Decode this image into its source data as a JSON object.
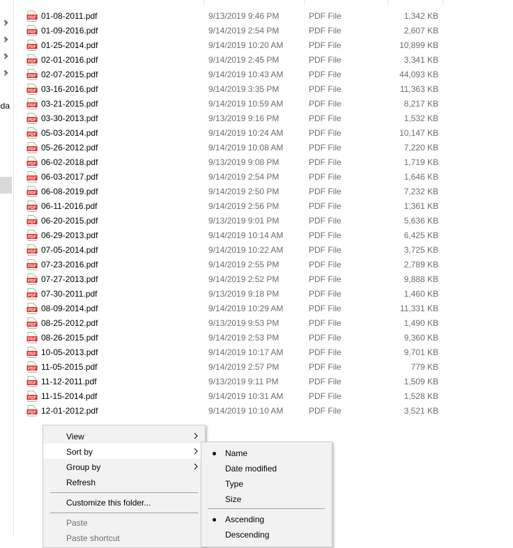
{
  "files": [
    {
      "name": "01-08-2011.pdf",
      "date": "9/13/2019 9:46 PM",
      "type": "PDF File",
      "size": "1,342 KB"
    },
    {
      "name": "01-09-2016.pdf",
      "date": "9/14/2019 2:54 PM",
      "type": "PDF File",
      "size": "2,607 KB"
    },
    {
      "name": "01-25-2014.pdf",
      "date": "9/14/2019 10:20 AM",
      "type": "PDF File",
      "size": "10,899 KB"
    },
    {
      "name": "02-01-2016.pdf",
      "date": "9/14/2019 2:45 PM",
      "type": "PDF File",
      "size": "3,341 KB"
    },
    {
      "name": "02-07-2015.pdf",
      "date": "9/14/2019 10:43 AM",
      "type": "PDF File",
      "size": "44,093 KB"
    },
    {
      "name": "03-16-2016.pdf",
      "date": "9/14/2019 3:35 PM",
      "type": "PDF File",
      "size": "11,363 KB"
    },
    {
      "name": "03-21-2015.pdf",
      "date": "9/14/2019 10:59 AM",
      "type": "PDF File",
      "size": "8,217 KB"
    },
    {
      "name": "03-30-2013.pdf",
      "date": "9/13/2019 9:16 PM",
      "type": "PDF File",
      "size": "1,532 KB"
    },
    {
      "name": "05-03-2014.pdf",
      "date": "9/14/2019 10:24 AM",
      "type": "PDF File",
      "size": "10,147 KB"
    },
    {
      "name": "05-26-2012.pdf",
      "date": "9/14/2019 10:08 AM",
      "type": "PDF File",
      "size": "7,220 KB"
    },
    {
      "name": "06-02-2018.pdf",
      "date": "9/13/2019 9:08 PM",
      "type": "PDF File",
      "size": "1,719 KB"
    },
    {
      "name": "06-03-2017.pdf",
      "date": "9/14/2019 2:54 PM",
      "type": "PDF File",
      "size": "1,646 KB"
    },
    {
      "name": "06-08-2019.pdf",
      "date": "9/14/2019 2:50 PM",
      "type": "PDF File",
      "size": "7,232 KB"
    },
    {
      "name": "06-11-2016.pdf",
      "date": "9/14/2019 2:56 PM",
      "type": "PDF File",
      "size": "1,361 KB"
    },
    {
      "name": "06-20-2015.pdf",
      "date": "9/13/2019 9:01 PM",
      "type": "PDF File",
      "size": "5,636 KB"
    },
    {
      "name": "06-29-2013.pdf",
      "date": "9/14/2019 10:14 AM",
      "type": "PDF File",
      "size": "6,425 KB"
    },
    {
      "name": "07-05-2014.pdf",
      "date": "9/14/2019 10:22 AM",
      "type": "PDF File",
      "size": "3,725 KB"
    },
    {
      "name": "07-23-2016.pdf",
      "date": "9/14/2019 2:55 PM",
      "type": "PDF File",
      "size": "2,789 KB"
    },
    {
      "name": "07-27-2013.pdf",
      "date": "9/14/2019 2:52 PM",
      "type": "PDF File",
      "size": "9,888 KB"
    },
    {
      "name": "07-30-2011.pdf",
      "date": "9/13/2019 9:18 PM",
      "type": "PDF File",
      "size": "1,460 KB"
    },
    {
      "name": "08-09-2014.pdf",
      "date": "9/14/2019 10:29 AM",
      "type": "PDF File",
      "size": "11,331 KB"
    },
    {
      "name": "08-25-2012.pdf",
      "date": "9/13/2019 9:53 PM",
      "type": "PDF File",
      "size": "1,490 KB"
    },
    {
      "name": "08-26-2015.pdf",
      "date": "9/14/2019 2:53 PM",
      "type": "PDF File",
      "size": "9,360 KB"
    },
    {
      "name": "10-05-2013.pdf",
      "date": "9/14/2019 10:17 AM",
      "type": "PDF File",
      "size": "9,701 KB"
    },
    {
      "name": "11-05-2015.pdf",
      "date": "9/14/2019 2:57 PM",
      "type": "PDF File",
      "size": "779 KB"
    },
    {
      "name": "11-12-2011.pdf",
      "date": "9/13/2019 9:11 PM",
      "type": "PDF File",
      "size": "1,509 KB"
    },
    {
      "name": "11-15-2014.pdf",
      "date": "9/14/2019 10:31 AM",
      "type": "PDF File",
      "size": "1,528 KB"
    },
    {
      "name": "12-01-2012.pdf",
      "date": "9/14/2019 10:10 AM",
      "type": "PDF File",
      "size": "3,521 KB"
    }
  ],
  "file_icon_text": "PDF",
  "nav": {
    "cut_label": "oda"
  },
  "context_menu": {
    "view": "View",
    "sort_by": "Sort by",
    "group_by": "Group by",
    "refresh": "Refresh",
    "customize": "Customize this folder...",
    "paste": "Paste",
    "paste_shortcut": "Paste shortcut"
  },
  "sort_submenu": {
    "name": "Name",
    "date_modified": "Date modified",
    "type": "Type",
    "size": "Size",
    "ascending": "Ascending",
    "descending": "Descending"
  },
  "colors": {
    "pdf_red": "#d9261c",
    "menu_bg": "#f2f2f2",
    "highlight": "#ffffff",
    "secondary_text": "#6d6d6d"
  },
  "icons": {
    "file": "pdf-file-icon",
    "pin": "pin-icon",
    "submenu": "chevron-right-icon",
    "radio": "bullet-icon"
  }
}
